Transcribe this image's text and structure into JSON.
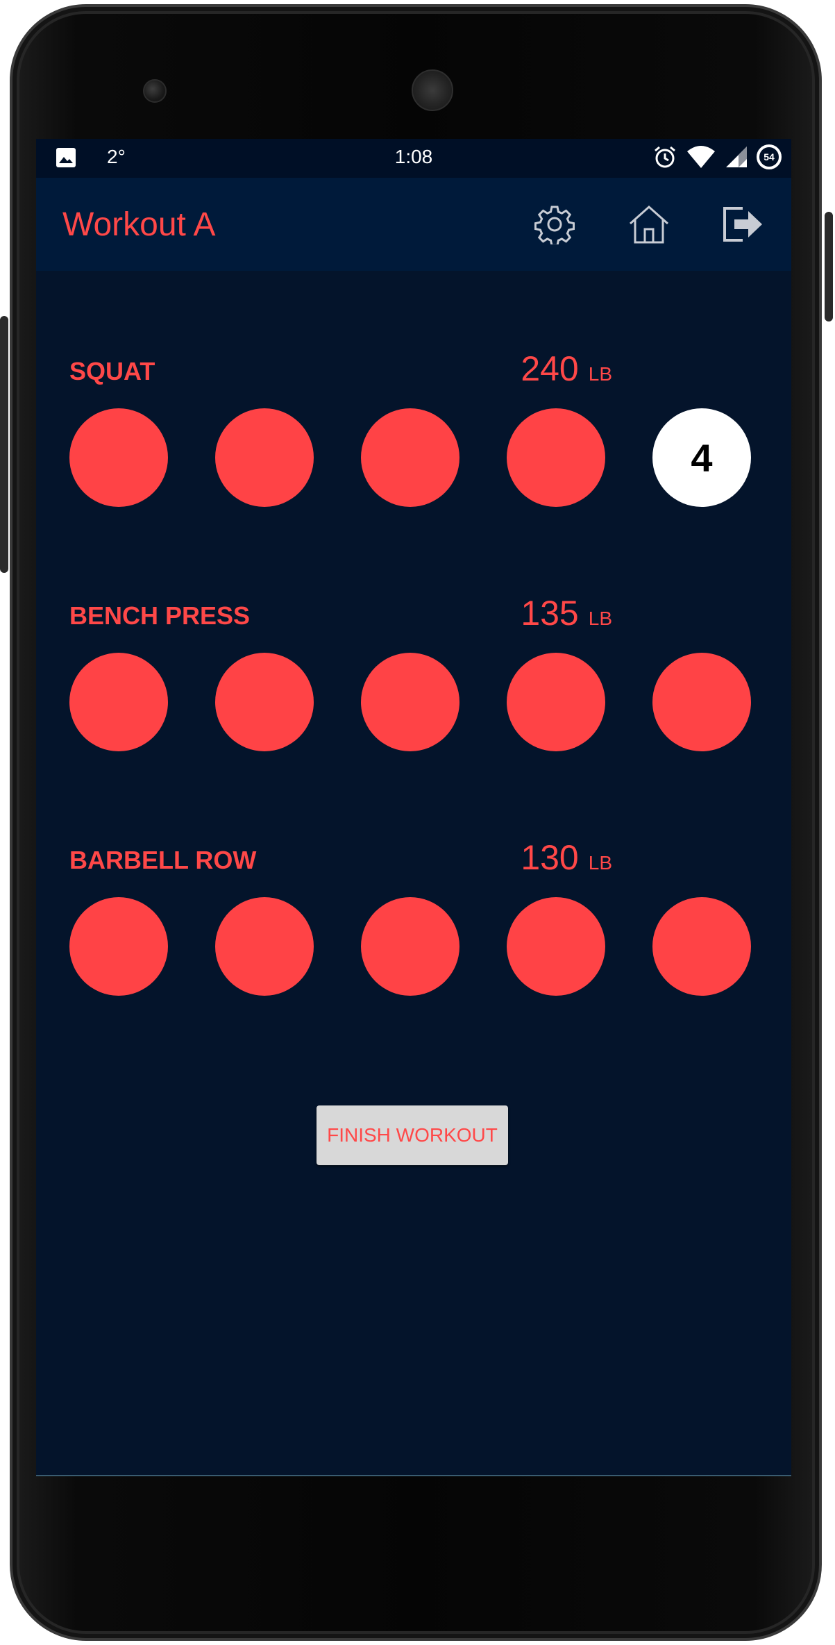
{
  "status_bar": {
    "temperature": "2°",
    "time": "1:08",
    "battery": "54",
    "icons": [
      "image-icon",
      "alarm-icon",
      "wifi-icon",
      "signal-icon",
      "battery-icon"
    ]
  },
  "app_bar": {
    "title": "Workout A",
    "actions": [
      "settings-gear-icon",
      "home-icon",
      "logout-icon"
    ]
  },
  "exercises": [
    {
      "name": "SQUAT",
      "weight": "240",
      "unit": "LB",
      "sets": [
        "",
        "",
        "",
        "",
        "4"
      ],
      "active_set": 4
    },
    {
      "name": "BENCH PRESS",
      "weight": "135",
      "unit": "LB",
      "sets": [
        "",
        "",
        "",
        "",
        ""
      ]
    },
    {
      "name": "BARBELL ROW",
      "weight": "130",
      "unit": "LB",
      "sets": [
        "",
        "",
        "",
        "",
        ""
      ]
    }
  ],
  "finish_button": "FINISH WORKOUT",
  "colors": {
    "accent": "#ff4848",
    "background": "#04142b",
    "app_bar": "#001a3a",
    "set_complete": "#ff4346",
    "set_active": "#ffffff"
  }
}
